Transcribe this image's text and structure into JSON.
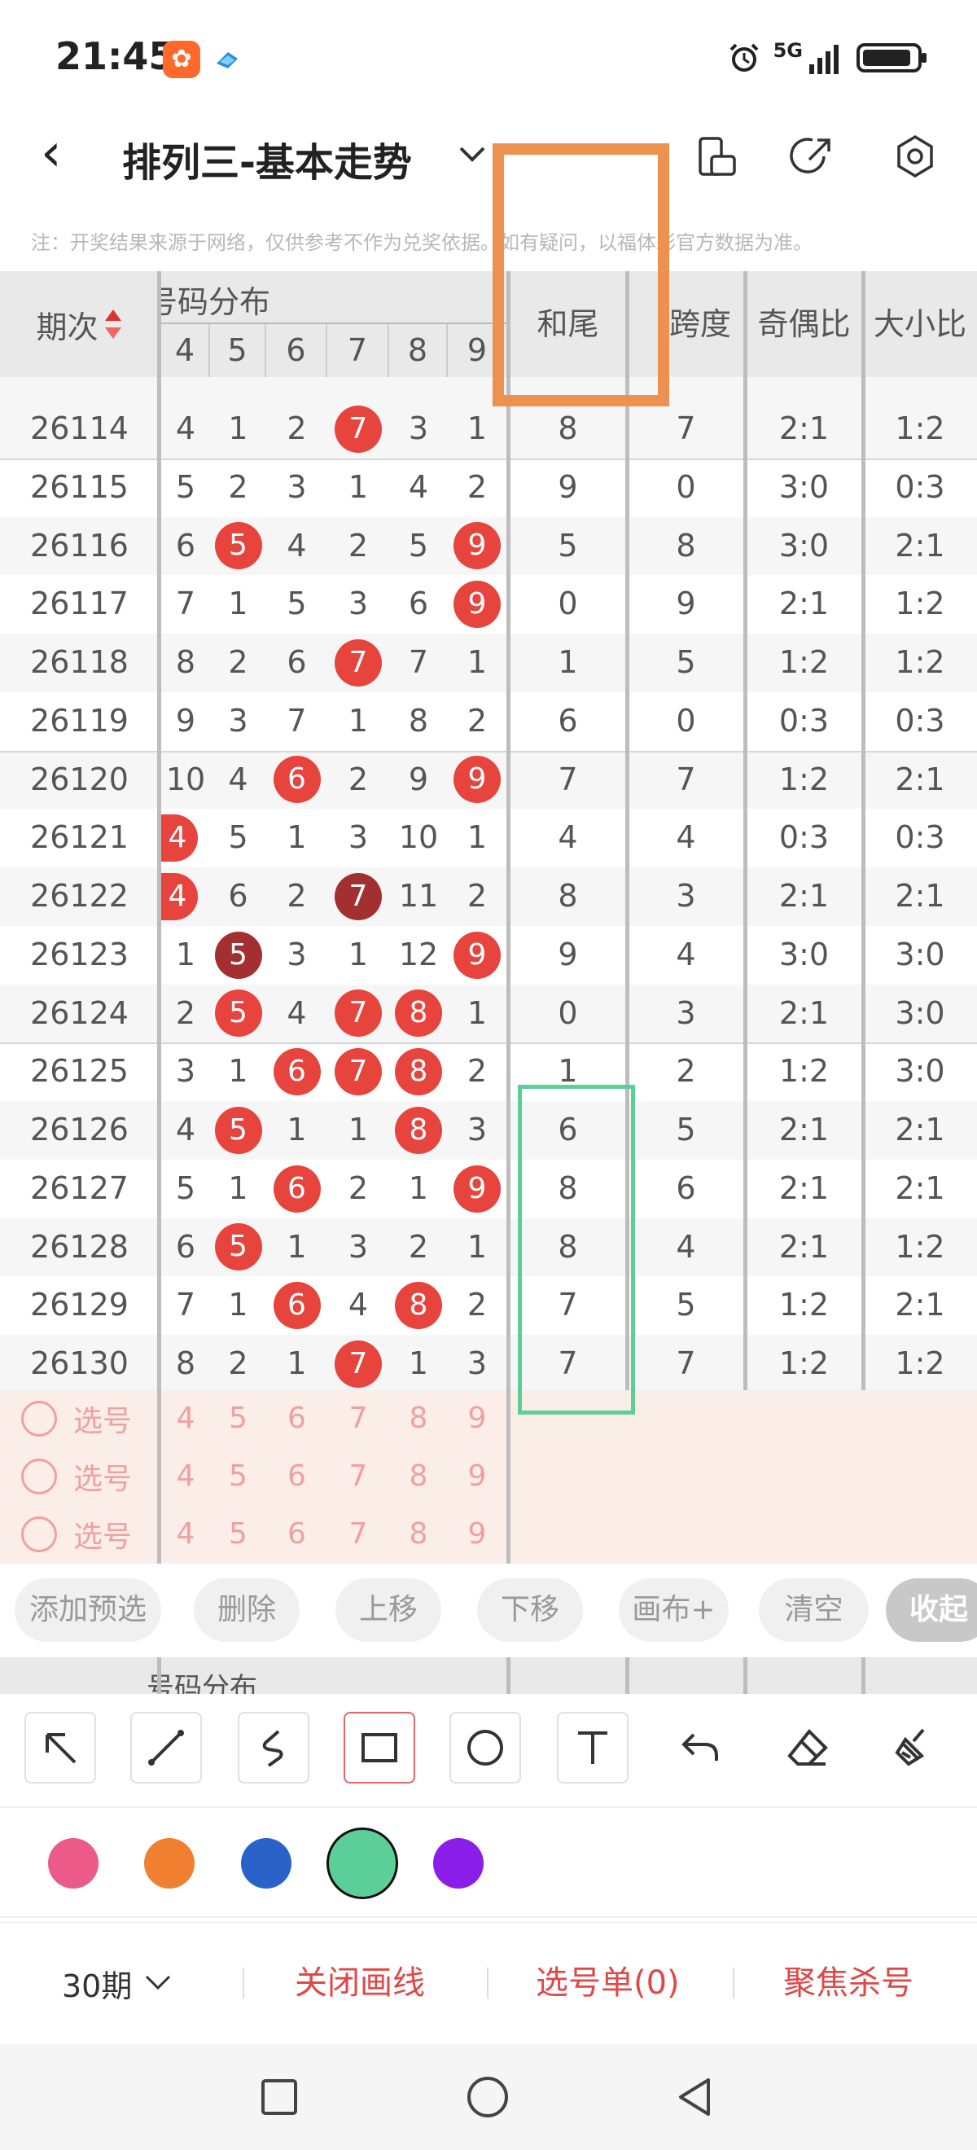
{
  "status": {
    "time": "21:45",
    "network": "5G"
  },
  "header": {
    "title": "排列三-基本走势"
  },
  "note": "注：开奖结果来源于网络，仅供参考不作为兑奖依据。如有疑问，以福体彩官方数据为准。",
  "table": {
    "col_issue": "期次",
    "col_group": "号码分布",
    "col_group_visible": "号码分布",
    "digits": [
      "4",
      "5",
      "6",
      "7",
      "8",
      "9"
    ],
    "col_sum_tail": "和尾",
    "col_span": "跨度",
    "col_odd_even": "奇偶比",
    "col_big_small": "大小比",
    "rows": [
      {
        "issue": "26114",
        "d": [
          "4",
          "1",
          "2",
          "7",
          "3",
          "1"
        ],
        "hit": [
          3
        ],
        "tail": "8",
        "span": "7",
        "oe": "2:1",
        "bs": "1:2"
      },
      {
        "issue": "26115",
        "d": [
          "5",
          "2",
          "3",
          "1",
          "4",
          "2"
        ],
        "hit": [],
        "tail": "9",
        "span": "0",
        "oe": "3:0",
        "bs": "0:3"
      },
      {
        "issue": "26116",
        "d": [
          "6",
          "5",
          "4",
          "2",
          "5",
          "9"
        ],
        "hit": [
          1,
          5
        ],
        "tail": "5",
        "span": "8",
        "oe": "3:0",
        "bs": "2:1"
      },
      {
        "issue": "26117",
        "d": [
          "7",
          "1",
          "5",
          "3",
          "6",
          "9"
        ],
        "hit": [
          5
        ],
        "tail": "0",
        "span": "9",
        "oe": "2:1",
        "bs": "1:2"
      },
      {
        "issue": "26118",
        "d": [
          "8",
          "2",
          "6",
          "7",
          "7",
          "1"
        ],
        "hit": [
          3
        ],
        "tail": "1",
        "span": "5",
        "oe": "1:2",
        "bs": "1:2"
      },
      {
        "issue": "26119",
        "d": [
          "9",
          "3",
          "7",
          "1",
          "8",
          "2"
        ],
        "hit": [],
        "tail": "6",
        "span": "0",
        "oe": "0:3",
        "bs": "0:3"
      },
      {
        "issue": "26120",
        "d": [
          "10",
          "4",
          "6",
          "2",
          "9",
          "9"
        ],
        "hit": [
          2,
          5
        ],
        "tail": "7",
        "span": "7",
        "oe": "1:2",
        "bs": "2:1"
      },
      {
        "issue": "26121",
        "d": [
          "4",
          "5",
          "1",
          "3",
          "10",
          "1"
        ],
        "hit": [
          0
        ],
        "tail": "4",
        "span": "4",
        "oe": "0:3",
        "bs": "0:3"
      },
      {
        "issue": "26122",
        "d": [
          "4",
          "6",
          "2",
          "7",
          "11",
          "2"
        ],
        "hit": [
          0
        ],
        "dark": [
          3
        ],
        "tail": "8",
        "span": "3",
        "oe": "2:1",
        "bs": "2:1"
      },
      {
        "issue": "26123",
        "d": [
          "1",
          "5",
          "3",
          "1",
          "12",
          "9"
        ],
        "hit": [
          5
        ],
        "dark": [
          1
        ],
        "tail": "9",
        "span": "4",
        "oe": "3:0",
        "bs": "3:0"
      },
      {
        "issue": "26124",
        "d": [
          "2",
          "5",
          "4",
          "7",
          "8",
          "1"
        ],
        "hit": [
          1,
          3,
          4
        ],
        "tail": "0",
        "span": "3",
        "oe": "2:1",
        "bs": "3:0"
      },
      {
        "issue": "26125",
        "d": [
          "3",
          "1",
          "6",
          "7",
          "8",
          "2"
        ],
        "hit": [
          2,
          3,
          4
        ],
        "tail": "1",
        "span": "2",
        "oe": "1:2",
        "bs": "3:0"
      },
      {
        "issue": "26126",
        "d": [
          "4",
          "5",
          "1",
          "1",
          "8",
          "3"
        ],
        "hit": [
          1,
          4
        ],
        "tail": "6",
        "span": "5",
        "oe": "2:1",
        "bs": "2:1"
      },
      {
        "issue": "26127",
        "d": [
          "5",
          "1",
          "6",
          "2",
          "1",
          "9"
        ],
        "hit": [
          2,
          5
        ],
        "tail": "8",
        "span": "6",
        "oe": "2:1",
        "bs": "2:1"
      },
      {
        "issue": "26128",
        "d": [
          "6",
          "5",
          "1",
          "3",
          "2",
          "1"
        ],
        "hit": [
          1
        ],
        "tail": "8",
        "span": "4",
        "oe": "2:1",
        "bs": "1:2"
      },
      {
        "issue": "26129",
        "d": [
          "7",
          "1",
          "6",
          "4",
          "8",
          "2"
        ],
        "hit": [
          2,
          4
        ],
        "tail": "7",
        "span": "5",
        "oe": "1:2",
        "bs": "2:1"
      },
      {
        "issue": "26130",
        "d": [
          "8",
          "2",
          "1",
          "7",
          "1",
          "3"
        ],
        "hit": [
          3
        ],
        "tail": "7",
        "span": "7",
        "oe": "1:2",
        "bs": "1:2"
      }
    ],
    "select_label": "选号"
  },
  "actions": {
    "add": "添加预选",
    "delete": "删除",
    "up": "上移",
    "down": "下移",
    "canvas": "画布+",
    "clear": "清空",
    "collapse": "收起"
  },
  "colors": [
    "#ec5a8a",
    "#f08030",
    "#2a62c9",
    "#5ccf98",
    "#8a1ee8"
  ],
  "bottom": {
    "period": "30期",
    "close_lines": "关闭画线",
    "pick_list": "选号单(0)",
    "focus_kill": "聚焦杀号"
  }
}
